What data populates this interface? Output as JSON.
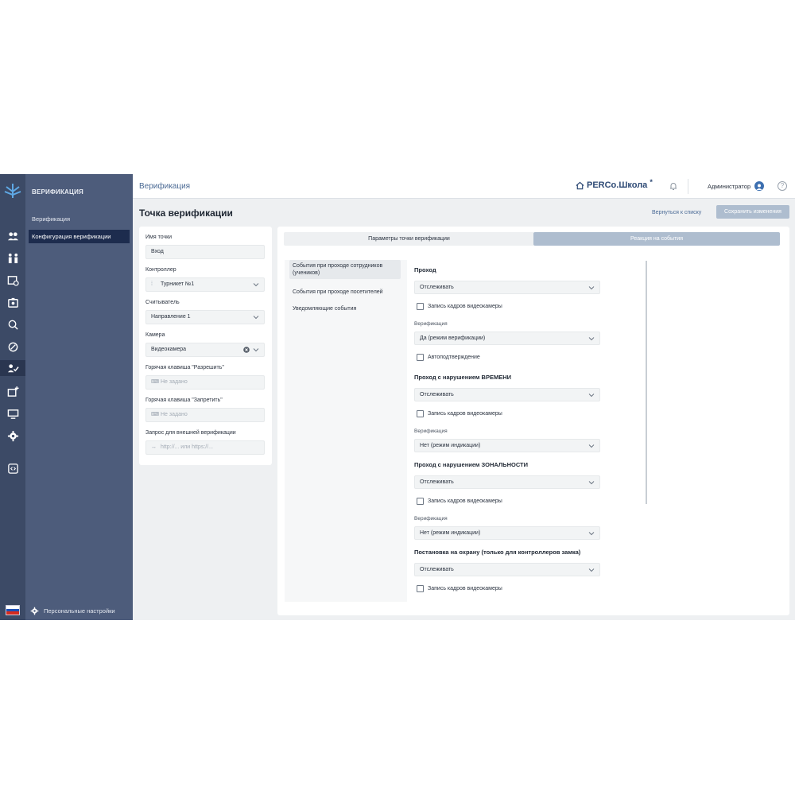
{
  "sidebar": {
    "section_title": "ВЕРИФИКАЦИЯ",
    "items": [
      {
        "label": "Верификация"
      },
      {
        "label": "Конфигурация верификации"
      }
    ],
    "personal_settings": "Персональные настройки"
  },
  "topbar": {
    "title": "Верификация",
    "brand": "PERCo.Школа",
    "user": "Администратор",
    "help": "?"
  },
  "page": {
    "title": "Точка верификации",
    "back_link": "Вернуться к списку",
    "save_button": "Сохранить изменения"
  },
  "form": {
    "name_label": "Имя точки",
    "name_value": "Вход",
    "controller_label": "Контроллер",
    "controller_value": "Турникет №1",
    "reader_label": "Считыватель",
    "reader_value": "Направление 1",
    "camera_label": "Камера",
    "camera_value": "Видеокамера",
    "hotkey_allow_label": "Горячая клавиша \"Разрешить\"",
    "hotkey_allow_value": "Не задано",
    "hotkey_deny_label": "Горячая клавиша \"Запретить\"",
    "hotkey_deny_value": "Не задано",
    "ext_request_label": "Запрос для внешней верификации",
    "ext_request_placeholder": "http://... или https://..."
  },
  "tabs": [
    {
      "label": "Параметры точки верификации"
    },
    {
      "label": "Реакция на события"
    }
  ],
  "event_groups": [
    {
      "label": "События при проходе сотрудников (учеников)"
    },
    {
      "label": "События при проходе посетителей"
    },
    {
      "label": "Уведомляющие события"
    }
  ],
  "sections": {
    "pass": {
      "title": "Проход",
      "mode": "Отслеживать",
      "record": "Запись кадров видеокамеры",
      "verif_label": "Верификация",
      "verif_value": "Да (режим верификации)",
      "auto": "Автоподтверждение"
    },
    "time": {
      "title": "Проход с нарушением ВРЕМЕНИ",
      "mode": "Отслеживать",
      "record": "Запись кадров видеокамеры",
      "verif_label": "Верификация",
      "verif_value": "Нет (режим индикации)"
    },
    "zone": {
      "title": "Проход с нарушением ЗОНАЛЬНОСТИ",
      "mode": "Отслеживать",
      "record": "Запись кадров видеокамеры",
      "verif_label": "Верификация",
      "verif_value": "Нет (режим индикации)"
    },
    "guard": {
      "title": "Постановка на охрану (только для контроллеров замка)",
      "mode": "Отслеживать",
      "record": "Запись кадров видеокамеры"
    }
  },
  "colors": {
    "rail": "#3c4a66",
    "menu": "#4d5c7b",
    "menu_active": "#1d2c4e",
    "accent": "#aebdcf",
    "brand": "#2e4a75"
  }
}
